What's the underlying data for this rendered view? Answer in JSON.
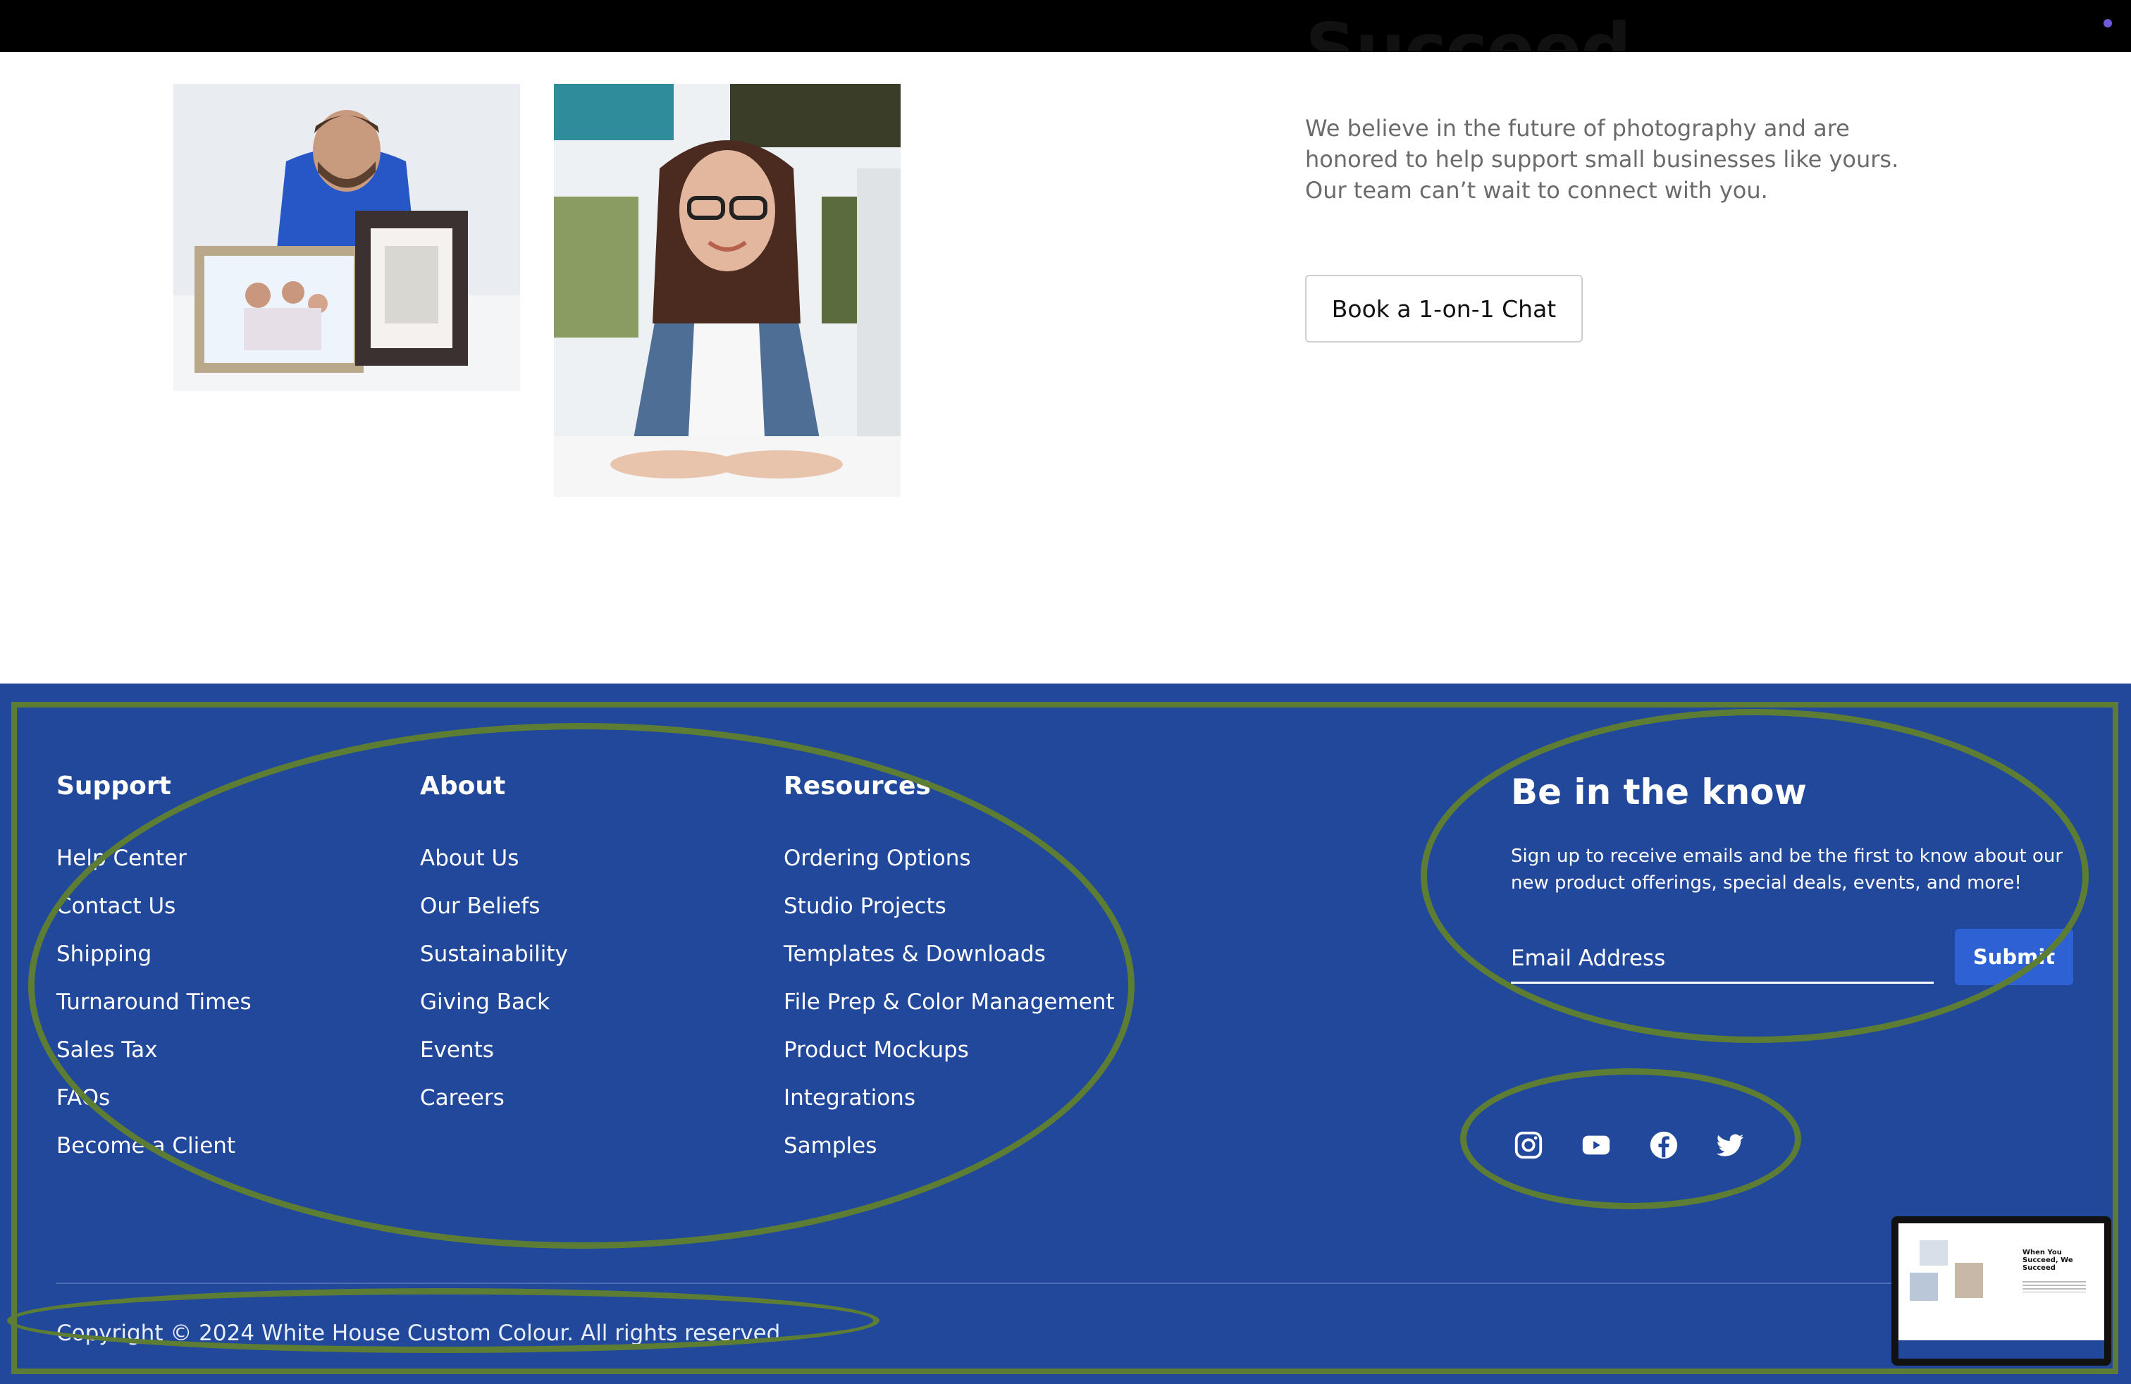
{
  "hero": {
    "heading": "Succeed",
    "intro": "We believe in the future of photography and are honored to help support small businesses like yours. Our team can’t wait to connect with you.",
    "cta_label": "Book a 1-on-1 Chat"
  },
  "footer": {
    "columns": [
      {
        "title": "Support",
        "links": [
          "Help Center",
          "Contact Us",
          "Shipping",
          "Turnaround Times",
          "Sales Tax",
          "FAQs",
          "Become a Client"
        ]
      },
      {
        "title": "About",
        "links": [
          "About Us",
          "Our Beliefs",
          "Sustainability",
          "Giving Back",
          "Events",
          "Careers"
        ]
      },
      {
        "title": "Resources",
        "links": [
          "Ordering Options",
          "Studio Projects",
          "Templates & Downloads",
          "File Prep & Color Management",
          "Product Mockups",
          "Integrations",
          "Samples"
        ]
      }
    ],
    "newsletter": {
      "title": "Be in the know",
      "text": "Sign up to receive emails and be the first to know about our new product offerings, special deals, events, and more!",
      "email_placeholder": "Email Address",
      "submit_label": "Submit"
    },
    "social_icons": [
      "instagram-icon",
      "youtube-icon",
      "facebook-icon",
      "twitter-icon"
    ],
    "copyright": "Copyright © 2024 White House Custom Colour. All rights reserved.",
    "thumbnail_title": "When You Succeed, We Succeed"
  },
  "colors": {
    "footer_bg": "#21489a",
    "annotation": "#5e7d34",
    "submit_bg": "#2e62d4"
  }
}
